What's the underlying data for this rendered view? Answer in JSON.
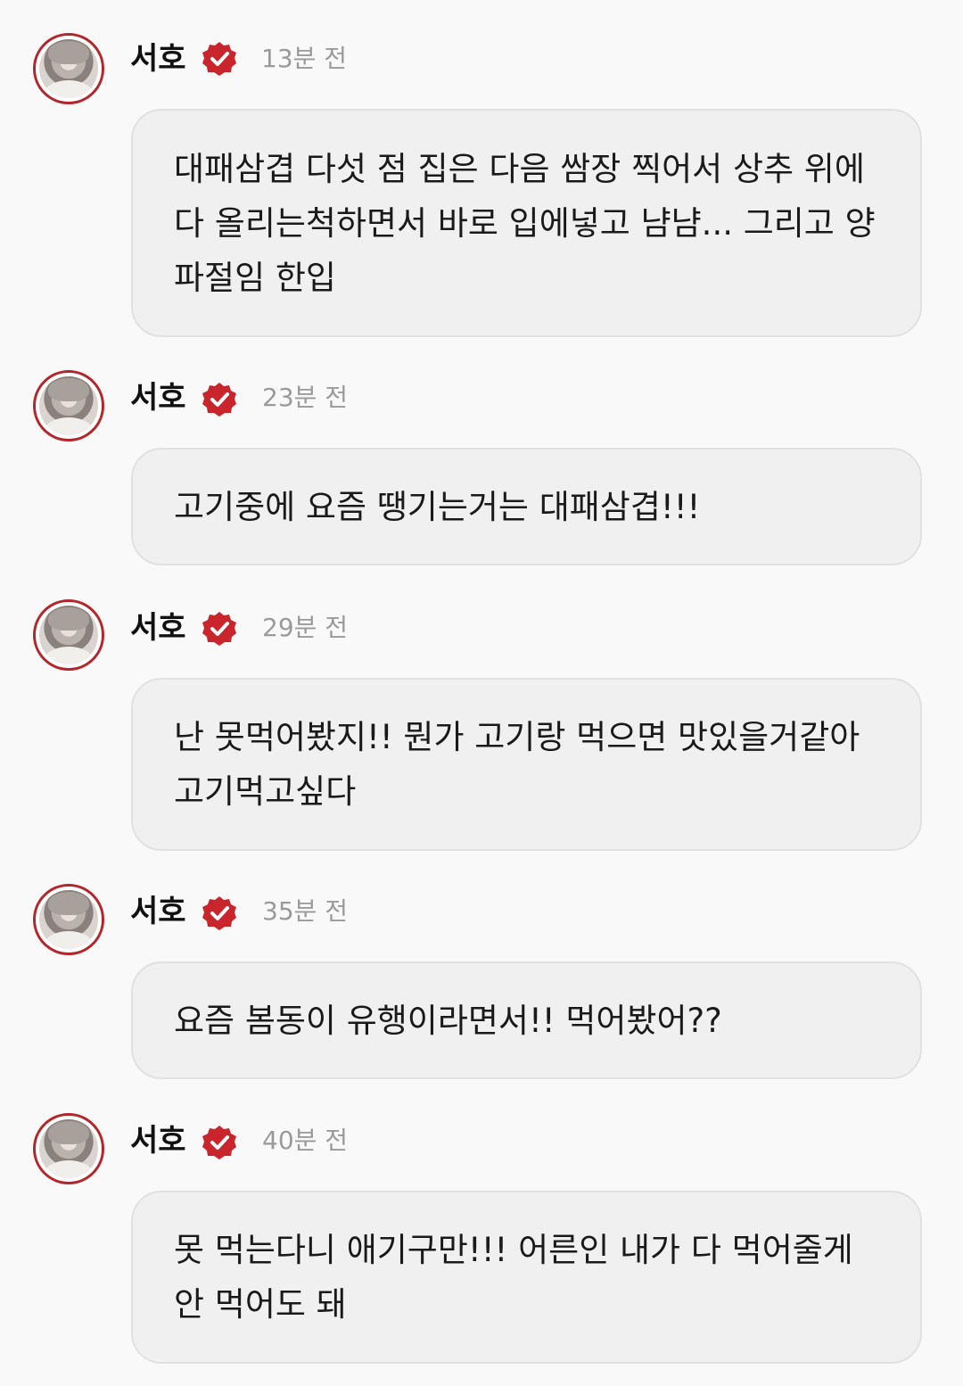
{
  "badge_color": "#c8252c",
  "comments": [
    {
      "author": "서호",
      "time": "13분 전",
      "avatar_icon": "profile-photo",
      "verified_icon": "verified-check-icon",
      "text": "대패삼겹 다섯 점 집은 다음 쌈장 찍어서 상추 위에다 올리는척하면서 바로 입에넣고 냠냠... 그리고 양파절임 한입"
    },
    {
      "author": "서호",
      "time": "23분 전",
      "avatar_icon": "profile-photo",
      "verified_icon": "verified-check-icon",
      "text": "고기중에 요즘 땡기는거는 대패삼겹!!!"
    },
    {
      "author": "서호",
      "time": "29분 전",
      "avatar_icon": "profile-photo",
      "verified_icon": "verified-check-icon",
      "text": "난 못먹어봤지!! 뭔가 고기랑 먹으면 맛있을거같아 고기먹고싶다"
    },
    {
      "author": "서호",
      "time": "35분 전",
      "avatar_icon": "profile-photo",
      "verified_icon": "verified-check-icon",
      "text": "요즘 봄동이 유행이라면서!! 먹어봤어??"
    },
    {
      "author": "서호",
      "time": "40분 전",
      "avatar_icon": "profile-photo",
      "verified_icon": "verified-check-icon",
      "text": "못 먹는다니 애기구만!!! 어른인 내가 다 먹어줄게 안 먹어도 돼"
    }
  ]
}
